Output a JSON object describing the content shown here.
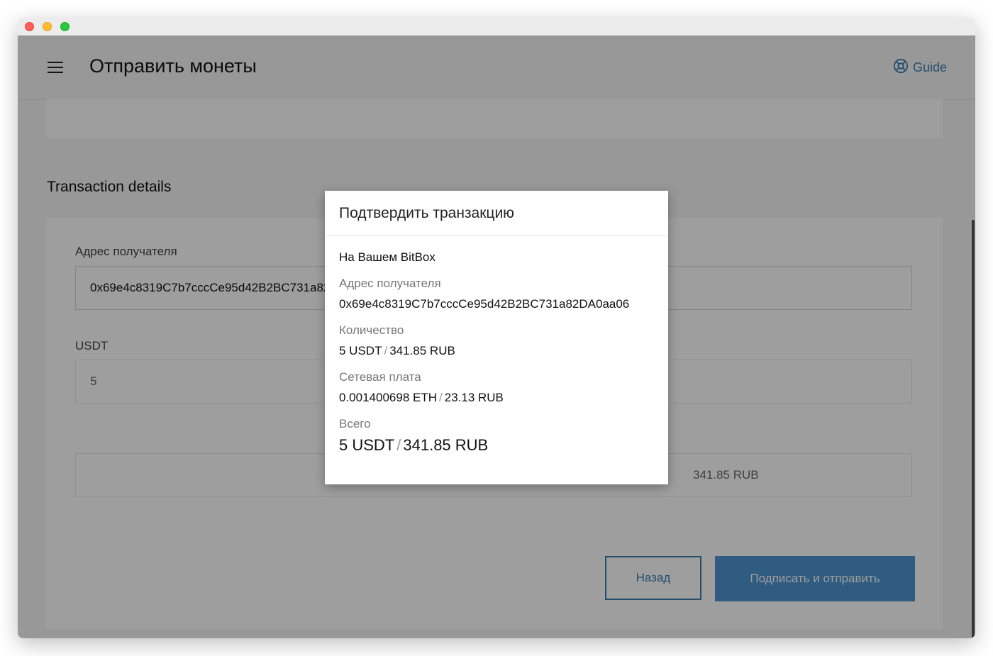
{
  "header": {
    "title": "Отправить монеты",
    "guide_label": "Guide"
  },
  "section": {
    "title": "Transaction details"
  },
  "form": {
    "recipient_label": "Адрес получателя",
    "recipient_value": "0x69e4c8319C7b7cccCe95d42B2BC731a82DA0aa06",
    "amount_label": "USDT",
    "amount_value": "5",
    "fiat_value": "341.85 RUB"
  },
  "buttons": {
    "back": "Назад",
    "sign": "Подписать и отправить"
  },
  "modal": {
    "title": "Подтвердить транзакцию",
    "device_text": "На Вашем BitBox",
    "recipient_label": "Адрес получателя",
    "recipient_value": "0x69e4c8319C7b7cccCe95d42B2BC731a82DA0aa06",
    "amount_label": "Количество",
    "amount_crypto": "5 USDT",
    "amount_fiat": "341.85 RUB",
    "fee_label": "Сетевая плата",
    "fee_crypto": "0.001400698 ETH",
    "fee_fiat": "23.13 RUB",
    "total_label": "Всего",
    "total_crypto": "5 USDT",
    "total_fiat": "341.85 RUB",
    "separator": "/"
  },
  "colors": {
    "accent": "#3d7eb0",
    "overlay": "rgba(0,0,0,0.38)"
  }
}
